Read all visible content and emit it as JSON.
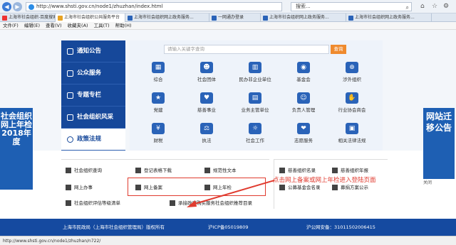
{
  "browser": {
    "url": "http://www.shsti.gov.cn/node1/zhuzhan/index.html",
    "search_placeholder": "搜索...",
    "tabs": [
      {
        "label": "上海市社会组织-百度搜索"
      },
      {
        "label": "上海市社会组织公共服务平台"
      },
      {
        "label": "上海市社会组织网上政务服务..."
      },
      {
        "label": "一网通办登录"
      },
      {
        "label": "上海市社会组织网上政务服务..."
      },
      {
        "label": "上海市社会组织网上政务服务..."
      }
    ],
    "menu": [
      "文件(F)",
      "编辑(E)",
      "查看(V)",
      "收藏夹(A)",
      "工具(T)",
      "帮助(H)"
    ],
    "status_url": "http://www.shsti.gov.cn/node1/zhuzhan/n722/"
  },
  "leftnav": [
    {
      "label": "通知公告"
    },
    {
      "label": "公众服务"
    },
    {
      "label": "专题专栏"
    },
    {
      "label": "社会组织风采"
    },
    {
      "label": "政策法规"
    }
  ],
  "grid": {
    "search_placeholder": "请输入关键字查询",
    "search_button": "查询",
    "cells": [
      {
        "label": "综合",
        "icon": "grid-icon"
      },
      {
        "label": "社会团体",
        "icon": "people-icon"
      },
      {
        "label": "民办非企业单位",
        "icon": "building-icon"
      },
      {
        "label": "基金会",
        "icon": "coins-icon"
      },
      {
        "label": "涉外组织",
        "icon": "globe-icon"
      },
      {
        "label": "党建",
        "icon": "party-icon"
      },
      {
        "label": "慈善事业",
        "icon": "heart-icon"
      },
      {
        "label": "业务主管单位",
        "icon": "bank-icon"
      },
      {
        "label": "负责人管理",
        "icon": "user-icon"
      },
      {
        "label": "行业协会商会",
        "icon": "handshake-icon"
      },
      {
        "label": "财税",
        "icon": "yuan-icon"
      },
      {
        "label": "执法",
        "icon": "gavel-icon"
      },
      {
        "label": "社会工作",
        "icon": "worker-icon"
      },
      {
        "label": "志愿服务",
        "icon": "volunteer-icon"
      },
      {
        "label": "相关法律法规",
        "icon": "book-icon"
      }
    ]
  },
  "banner_left": "社会组织网上年检 2018年度",
  "banner_right": "网站迁移公告",
  "banner_right_close": "关闭",
  "quick": {
    "row1": [
      "社会组织查询",
      "登记表格下载",
      "规范性文本"
    ],
    "row2": [
      "网上办事",
      "网上备案",
      "网上年检"
    ],
    "row3": [
      "社会组织评估等级清单",
      "承接政府购买服务社会组织推荐目录"
    ]
  },
  "right_quick": {
    "row1": [
      "慈善组织名录",
      "慈善组织年报"
    ],
    "row2": [
      "公募基金会名录",
      "募捐方案公示"
    ]
  },
  "callout": "点击网上备案或网上年检进入登陆页面",
  "footer": {
    "owner": "上海市民政局（上海市社会组织管理局）版权所有",
    "icp": "沪ICP备05019809",
    "police": "沪公网安备：31011502006415"
  }
}
